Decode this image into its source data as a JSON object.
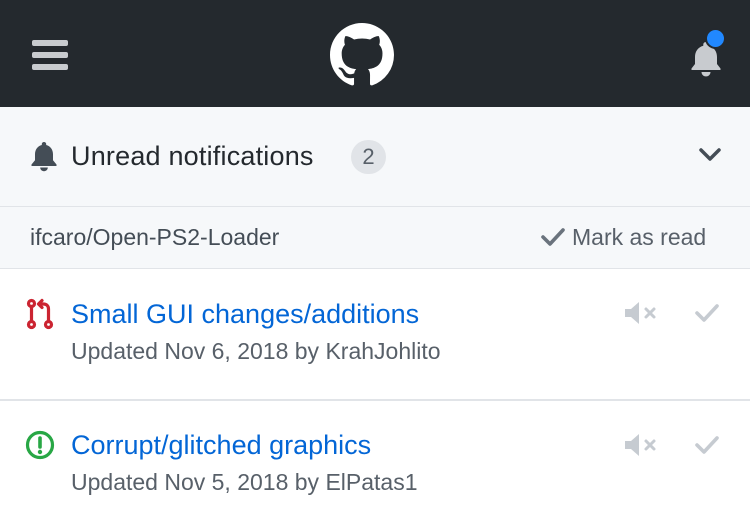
{
  "header": {
    "menu_icon": "hamburger-icon",
    "logo_icon": "github-octocat-icon",
    "bell_icon": "bell-icon",
    "has_unread_indicator": true,
    "colors": {
      "bar": "#24292e",
      "indicator": "#2188ff"
    }
  },
  "filter": {
    "title": "Unread notifications",
    "count": "2",
    "toggle_icon": "chevron-down-icon"
  },
  "repo": {
    "name": "ifcaro/Open-PS2-Loader",
    "mark_as_read_label": "Mark as read"
  },
  "notifications": [
    {
      "type": "pull-request",
      "icon": "git-pull-request-icon",
      "icon_color": "#cb2431",
      "title": "Small GUI changes/additions",
      "meta": "Updated Nov 6, 2018 by KrahJohlito"
    },
    {
      "type": "issue",
      "icon": "issue-opened-icon",
      "icon_color": "#28a745",
      "title": "Corrupt/glitched graphics",
      "meta": "Updated Nov 5, 2018 by ElPatas1"
    }
  ],
  "colors": {
    "link": "#0366d6",
    "muted": "#586069",
    "subtle_icon": "#c6cbd1"
  }
}
